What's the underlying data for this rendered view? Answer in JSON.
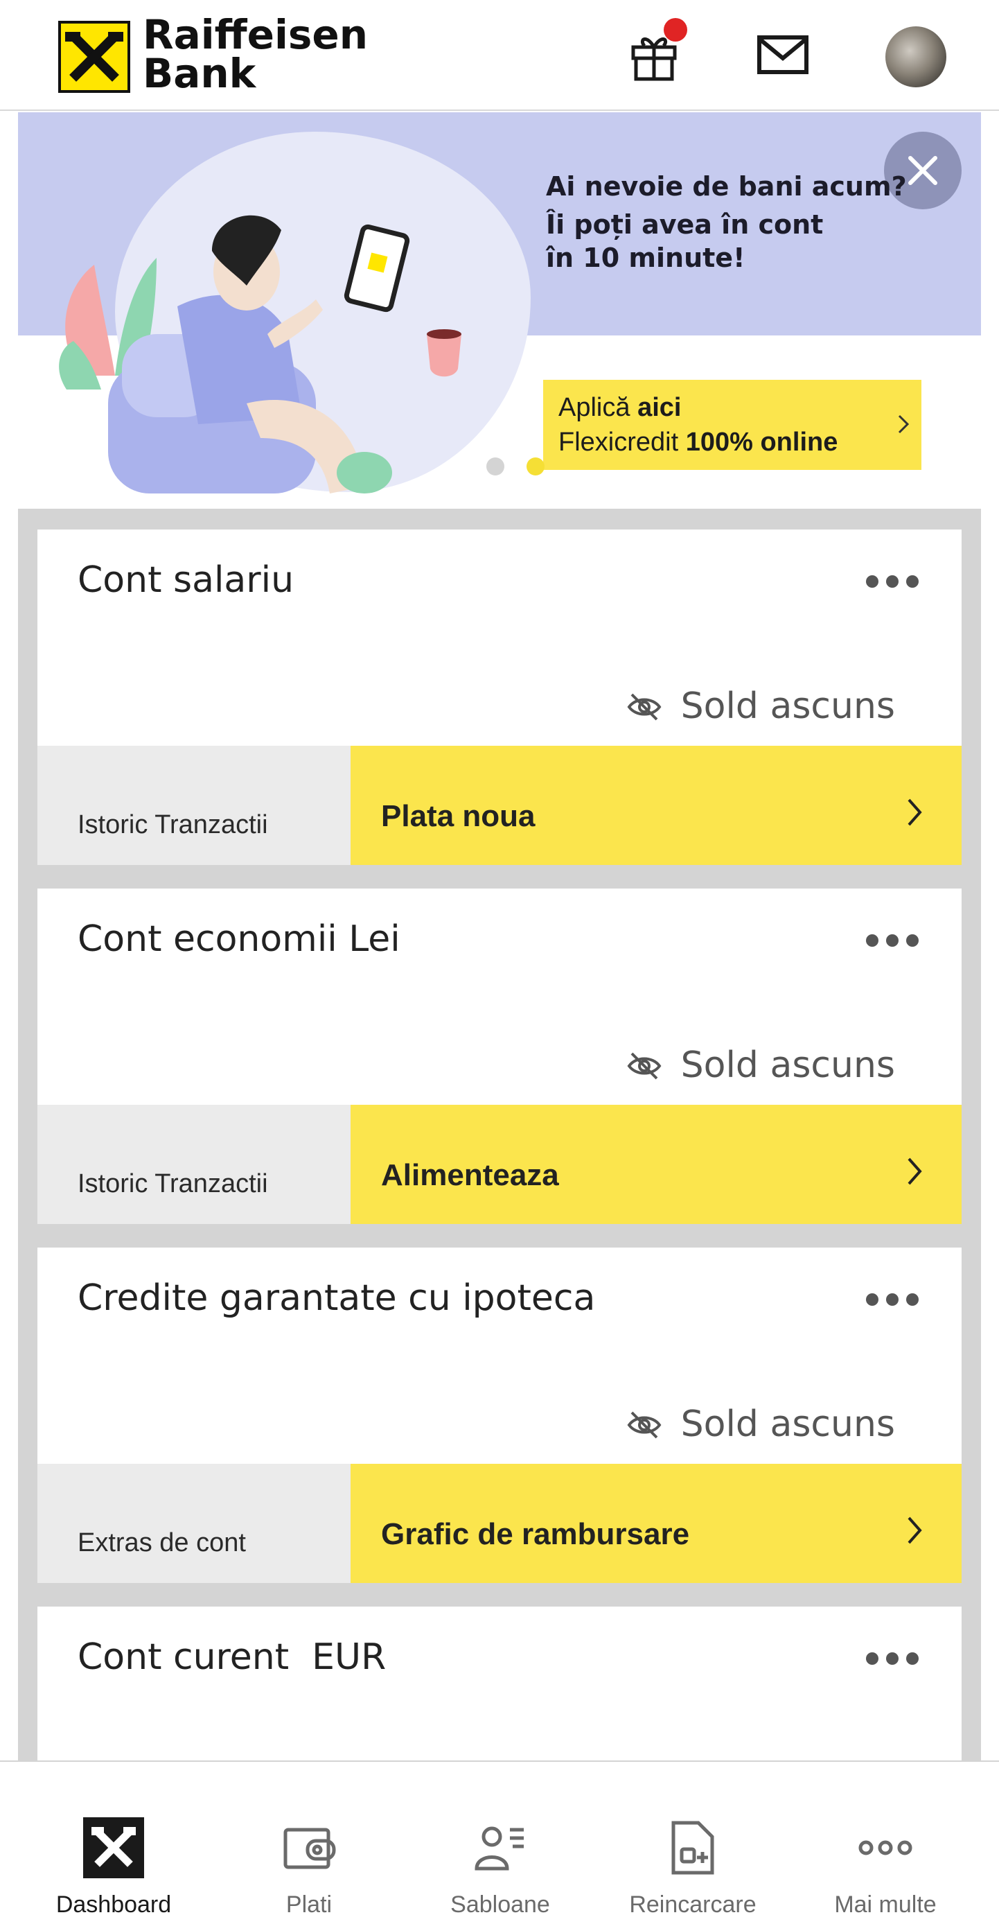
{
  "colors": {
    "brand_yellow": "#ffe600",
    "accent_yellow": "#fbe54d",
    "banner_bg": "#c6cbef",
    "notification_dot": "#e02424",
    "page_gray": "#d4d4d4"
  },
  "header": {
    "logo_text_line1": "Raiffeisen",
    "logo_text_line2": "Bank",
    "icons": [
      "gift-icon",
      "mail-icon",
      "avatar"
    ]
  },
  "banner": {
    "title": "Ai nevoie de bani acum?",
    "subtitle": "Îi poți avea în cont\nîn 10 minute!",
    "cta_prefix": "Aplică ",
    "cta_bold": "aici",
    "cta_line2_prefix": "Flexicredit ",
    "cta_line2_bold": "100% online",
    "pagination": {
      "count": 2,
      "active_index": 1
    }
  },
  "accounts": [
    {
      "name": "Cont salariu",
      "balance": "Sold ascuns",
      "left_action": "Istoric Tranzactii",
      "right_action": "Plata noua"
    },
    {
      "name": "Cont economii Lei",
      "balance": "Sold ascuns",
      "left_action": "Istoric Tranzactii",
      "right_action": "Alimenteaza"
    },
    {
      "name": "Credite garantate cu ipoteca",
      "balance": "Sold ascuns",
      "left_action": "Extras de cont",
      "right_action": "Grafic de rambursare"
    },
    {
      "name": "Cont curent  EUR"
    }
  ],
  "tabbar": {
    "active": "Dashboard",
    "items": [
      {
        "label": "Dashboard",
        "icon": "raiffeisen-logo-icon"
      },
      {
        "label": "Plati",
        "icon": "wallet-icon"
      },
      {
        "label": "Sabloane",
        "icon": "templates-icon"
      },
      {
        "label": "Reincarcare",
        "icon": "recharge-icon"
      },
      {
        "label": "Mai multe",
        "icon": "more-icon"
      }
    ]
  }
}
